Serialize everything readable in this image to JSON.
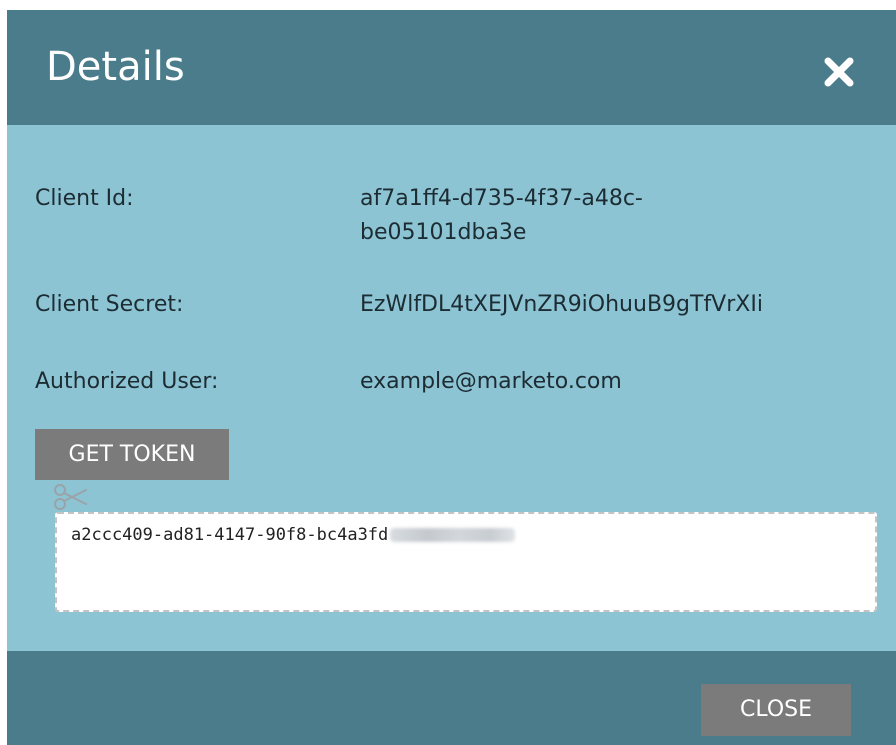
{
  "dialog": {
    "title": "Details",
    "close_icon": "close-x-icon"
  },
  "fields": [
    {
      "label": "Client Id:",
      "value": "af7a1ff4-d735-4f37-a48c-be05101dba3e"
    },
    {
      "label": "Client Secret:",
      "value": "EzWlfDL4tXEJVnZR9iOhuuB9gTfVrXIi"
    },
    {
      "label": "Authorized User:",
      "value": "example@marketo.com"
    }
  ],
  "token": {
    "button_label": "GET TOKEN",
    "copy_icon": "scissors-icon",
    "value_visible": "a2ccc409-ad81-4147-90f8-bc4a3fd"
  },
  "footer": {
    "close_label": "CLOSE"
  },
  "colors": {
    "header": "#4a7c8c",
    "body": "#8cc4d4",
    "button": "#7b7b7b"
  }
}
